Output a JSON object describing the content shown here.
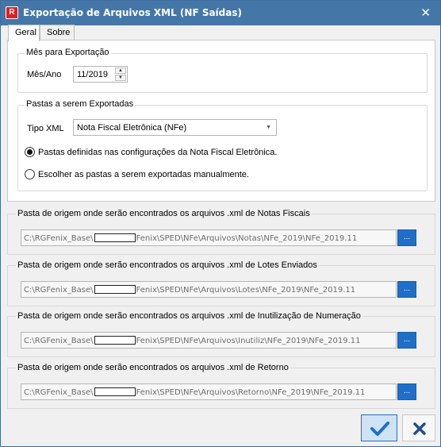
{
  "window": {
    "title": "Exportação de Arquivos XML (NF Saídas)",
    "close_glyph": "✕",
    "icon_letter": "R"
  },
  "tabs": [
    {
      "label": "Geral",
      "active": true
    },
    {
      "label": "Sobre",
      "active": false
    }
  ],
  "month_group": {
    "legend": "Mês para Exportação",
    "label": "Mês/Ano",
    "value": "11/2019",
    "up_glyph": "▲",
    "down_glyph": "▼"
  },
  "folders_group": {
    "legend": "Pastas a serem Exportadas",
    "type_label": "Tipo XML",
    "type_value": "Nota Fiscal Eletrônica (NFe)",
    "dropdown_glyph": "▼",
    "radio_1": "Pastas definidas nas configurações da Nota Fiscal Eletrônica.",
    "radio_2": "Escolher as pastas a serem exportadas manualmente.",
    "selected_option": 1
  },
  "paths": [
    {
      "legend": "Pasta de origem onde serão encontrados os arquivos .xml de Notas Fiscais",
      "prefix": "C:\\RGFenix_Base\\",
      "suffix": "Fenix\\SPED\\NFe\\Arquivos\\Notas\\NFe_2019\\NFe_2019.11",
      "button": "..."
    },
    {
      "legend": "Pasta de origem onde serão encontrados os arquivos .xml de Lotes Enviados",
      "prefix": "C:\\RGFenix_Base\\",
      "suffix": "Fenix\\SPED\\NFe\\Arquivos\\Lotes\\NFe_2019\\NFe_2019.11",
      "button": "..."
    },
    {
      "legend": "Pasta de origem onde serão encontrados os arquivos .xml de Inutilização de Numeração",
      "prefix": "C:\\RGFenix_Base\\",
      "suffix": "Fenix\\SPED\\NFe\\Arquivos\\Inutiliz\\NFe_2019\\NFe_2019.11",
      "button": "..."
    },
    {
      "legend": "Pasta de origem onde serão encontrados os arquivos .xml de Retorno",
      "prefix": "C:\\RGFenix_Base\\",
      "suffix": "Fenix\\SPED\\NFe\\Arquivos\\Retorno\\NFe_2019\\NFe_2019.11",
      "button": "..."
    }
  ],
  "colors": {
    "titlebar": "#4477a8",
    "accent": "#1f6fc9",
    "cancel_icon": "#1f4f8f"
  }
}
